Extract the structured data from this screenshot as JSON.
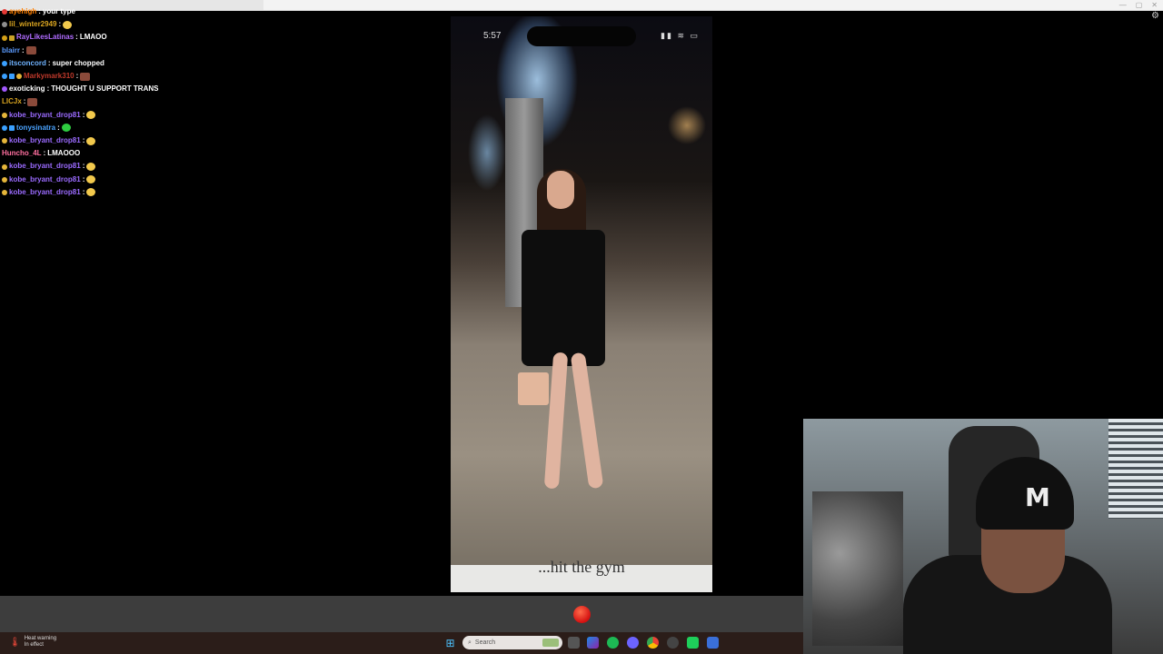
{
  "chat": [
    {
      "user": "ayehigh",
      "color": "#ff7f00",
      "badges": [
        "#e53935"
      ],
      "message": "your type",
      "emote": null
    },
    {
      "user": "lil_winter2949",
      "color": "#daa520",
      "badges": [
        "#8e8e8e"
      ],
      "message": "",
      "emote": "yellow"
    },
    {
      "user": "RayLikesLatinas",
      "color": "#b06cff",
      "badges": [
        "#d4a017",
        "#c9a227"
      ],
      "message": "LMAOO",
      "emote": null
    },
    {
      "user": "blairr",
      "color": "#5b9bff",
      "badges": [],
      "message": "",
      "emote": "brown"
    },
    {
      "user": "itsconcord",
      "color": "#6fb3ff",
      "badges": [
        "#3aa0ff"
      ],
      "message": "super chopped",
      "emote": null
    },
    {
      "user": "Markymark310",
      "color": "#c0392b",
      "badges": [
        "#3aa0ff",
        "#3aa0ff",
        "#e5b53a"
      ],
      "message": "",
      "emote": "brown"
    },
    {
      "user": "exoticking",
      "color": "#ffffff",
      "badges": [
        "#a259ff"
      ],
      "message": "THOUGHT U SUPPORT TRANS",
      "emote": null
    },
    {
      "user": "LICJx",
      "color": "#daa520",
      "badges": [],
      "message": "",
      "emote": "brown"
    },
    {
      "user": "kobe_bryant_drop81",
      "color": "#9b6bff",
      "badges": [
        "#e5b53a"
      ],
      "message": "",
      "emote": "yellow"
    },
    {
      "user": "tonysinatra",
      "color": "#4aa3ff",
      "badges": [
        "#3aa0ff",
        "#3aa0ff"
      ],
      "message": "",
      "emote": "green"
    },
    {
      "user": "kobe_bryant_drop81",
      "color": "#9b6bff",
      "badges": [
        "#e5b53a"
      ],
      "message": "",
      "emote": "yellow"
    },
    {
      "user": "Huncho_4L",
      "color": "#ff6f9f",
      "badges": [],
      "message": "LMAOOO",
      "emote": null
    },
    {
      "user": "kobe_bryant_drop81",
      "color": "#9b6bff",
      "badges": [
        "#e5b53a"
      ],
      "message": "",
      "emote": "yellow"
    },
    {
      "user": "kobe_bryant_drop81",
      "color": "#9b6bff",
      "badges": [
        "#e5b53a"
      ],
      "message": "",
      "emote": "yellow"
    },
    {
      "user": "kobe_bryant_drop81",
      "color": "#9b6bff",
      "badges": [
        "#e5b53a"
      ],
      "message": "",
      "emote": "yellow"
    }
  ],
  "phone": {
    "status_time": "5:57",
    "status_icons": "▮▮ ≋ ▭",
    "caption": "...hit the gym"
  },
  "taskbar": {
    "heat_title": "Heat warning",
    "heat_subtitle": "In effect",
    "search_placeholder": "Search"
  },
  "webcam": {
    "cap_logo": "M"
  }
}
